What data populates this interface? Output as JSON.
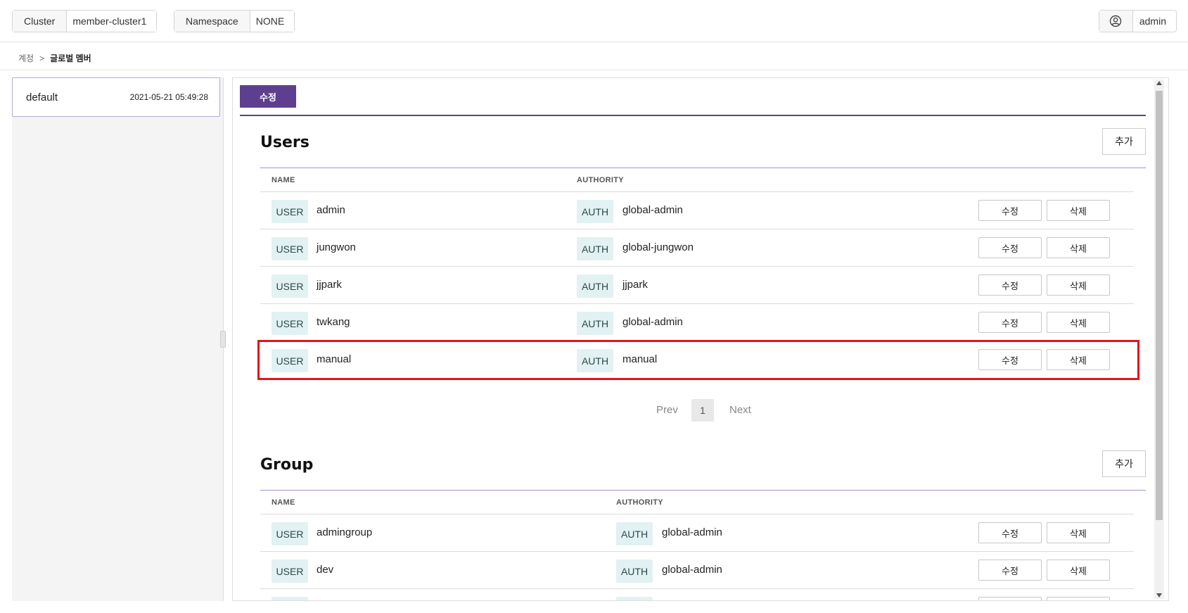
{
  "topbar": {
    "cluster_label": "Cluster",
    "cluster_value": "member-cluster1",
    "namespace_label": "Namespace",
    "namespace_value": "NONE",
    "user_name": "admin",
    "user_icon": "user-circle-icon"
  },
  "breadcrumb": {
    "parent": "계정",
    "separator": ">",
    "current": "글로벌 멤버"
  },
  "left_list": {
    "items": [
      {
        "name": "default",
        "date": "2021-05-21 05:49:28"
      }
    ]
  },
  "main": {
    "edit_tab": "수정",
    "users": {
      "title": "Users",
      "add_label": "추가",
      "col_name": "NAME",
      "col_authority": "AUTHORITY",
      "rows": [
        {
          "type": "USER",
          "name": "admin",
          "auth_type": "AUTH",
          "authority": "global-admin",
          "edit": "수정",
          "delete": "삭제"
        },
        {
          "type": "USER",
          "name": "jungwon",
          "auth_type": "AUTH",
          "authority": "global-jungwon",
          "edit": "수정",
          "delete": "삭제"
        },
        {
          "type": "USER",
          "name": "jjpark",
          "auth_type": "AUTH",
          "authority": "jjpark",
          "edit": "수정",
          "delete": "삭제"
        },
        {
          "type": "USER",
          "name": "twkang",
          "auth_type": "AUTH",
          "authority": "global-admin",
          "edit": "수정",
          "delete": "삭제"
        },
        {
          "type": "USER",
          "name": "manual",
          "auth_type": "AUTH",
          "authority": "manual",
          "edit": "수정",
          "delete": "삭제"
        }
      ],
      "pager": {
        "prev": "Prev",
        "page": "1",
        "next": "Next"
      }
    },
    "group": {
      "title": "Group",
      "add_label": "추가",
      "col_name": "NAME",
      "col_authority": "AUTHORITY",
      "rows": [
        {
          "type": "USER",
          "name": "admingroup",
          "auth_type": "AUTH",
          "authority": "global-admin",
          "edit": "수정",
          "delete": "삭제"
        },
        {
          "type": "USER",
          "name": "dev",
          "auth_type": "AUTH",
          "authority": "global-admin",
          "edit": "수정",
          "delete": "삭제"
        }
      ]
    }
  },
  "colors": {
    "accent": "#5e3f8f",
    "badge_bg": "#e2f1f1",
    "highlight": "#e0161f"
  }
}
